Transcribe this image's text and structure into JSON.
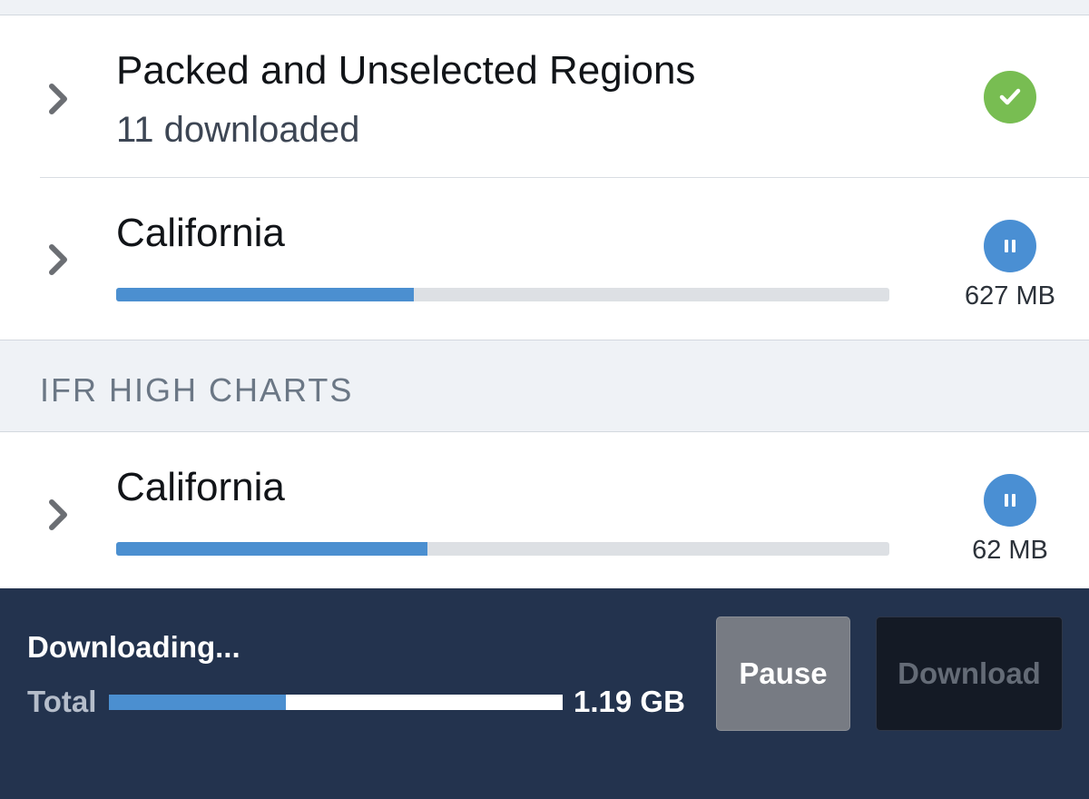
{
  "rows": [
    {
      "title": "Packed and Unselected Regions",
      "subtitle": "11 downloaded",
      "status_icon": "check-icon"
    },
    {
      "title": "California",
      "progress": 0.385,
      "status_icon": "pause-icon",
      "size": "627 MB"
    }
  ],
  "section": {
    "title": "IFR HIGH CHARTS",
    "rows": [
      {
        "title": "California",
        "progress": 0.402,
        "status_icon": "pause-icon",
        "size": "62 MB"
      }
    ]
  },
  "footer": {
    "status": "Downloading...",
    "total_label": "Total",
    "total_progress": 0.39,
    "total_size": "1.19 GB",
    "pause_label": "Pause",
    "download_label": "Download"
  },
  "colors": {
    "accent_blue": "#4b8fd0",
    "success_green": "#78bd52",
    "footer_bg": "#23334e"
  }
}
